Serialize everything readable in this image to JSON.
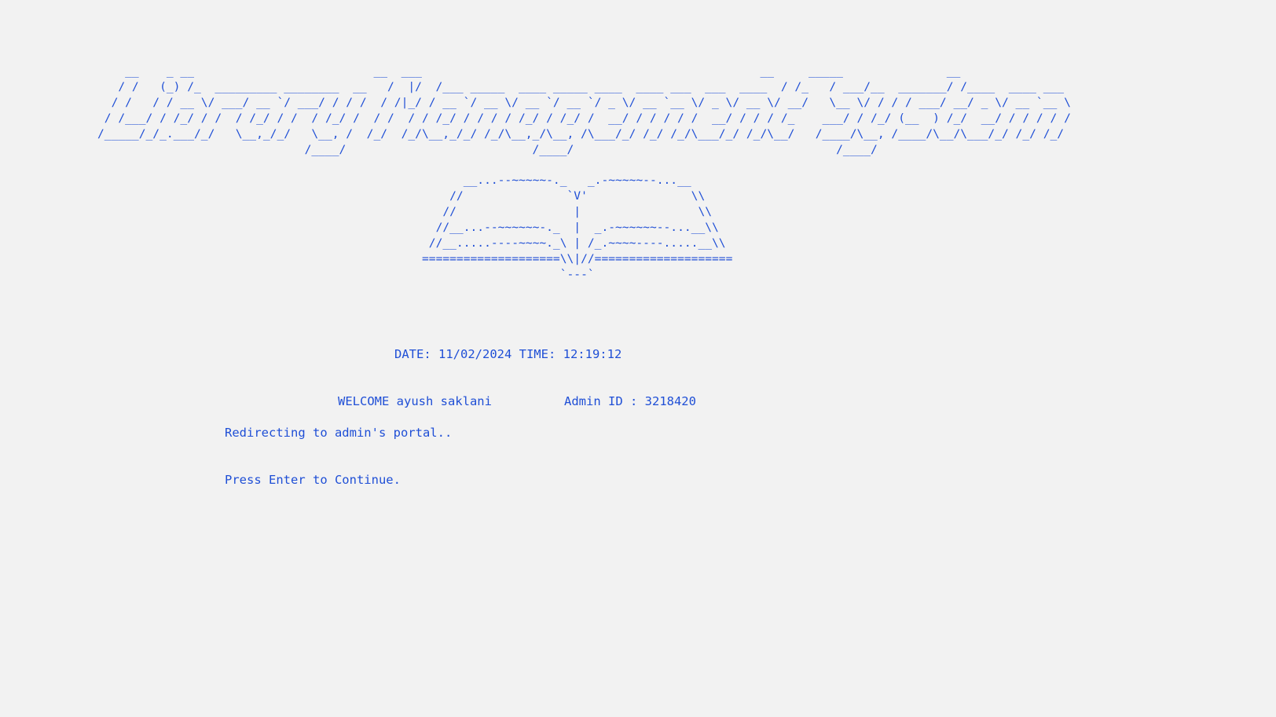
{
  "console": {
    "banner_art": "    __    _ __                          __  ___                                                 __     _____               __               \n   / /   (_) /_  _________ ________  __   /  |/  /___ _____  ____ _____ ____  ____ ___  ___  ____  / /_   / ___/__  _______/ /____  ____ ___ \n  / /   / / __ \\/ ___/ __ `/ ___/ / / /  / /|_/ / __ `/ __ \\/ __ `/ __ `/ _ \\/ __ `__ \\/ _ \\/ __ \\/ __/   \\__ \\/ / / / ___/ __/ _ \\/ __ `__ \\\n / /___/ / /_/ / /  / /_/ / /  / /_/ /  / /  / / /_/ / / / / /_/ / /_/ /  __/ / / / / /  __/ / / / /_    ___/ / /_/ (__  ) /_/  __/ / / / / /\n/_____/_/_.___/_/   \\__,_/_/   \\__, /  /_/  /_/\\__,_/_/ /_/\\__,_/\\__, /\\___/_/ /_/ /_/\\___/_/ /_/\\__/   /____/\\__, /____/\\__/\\___/_/ /_/ /_/ \n                              /____/                           /____/                                      /____/                          ",
    "book_art": "      __...--~~~~~-._   _.-~~~~~--...__\n    //               `V'               \\\\\n   //                 |                 \\\\\n  //__...--~~~~~~-._  |  _.-~~~~~~--...__\\\\\n //__.....----~~~~._\\ | /_.~~~~----.....__\\\\\n====================\\\\|//====================\n                    `---`",
    "datetime": "DATE: 11/02/2024 TIME: 12:19:12",
    "welcome": "WELCOME ayush saklani",
    "admin_id": "Admin ID : 3218420",
    "redirect_message": "Redirecting to admin's portal..",
    "prompt": "Press Enter to Continue."
  }
}
